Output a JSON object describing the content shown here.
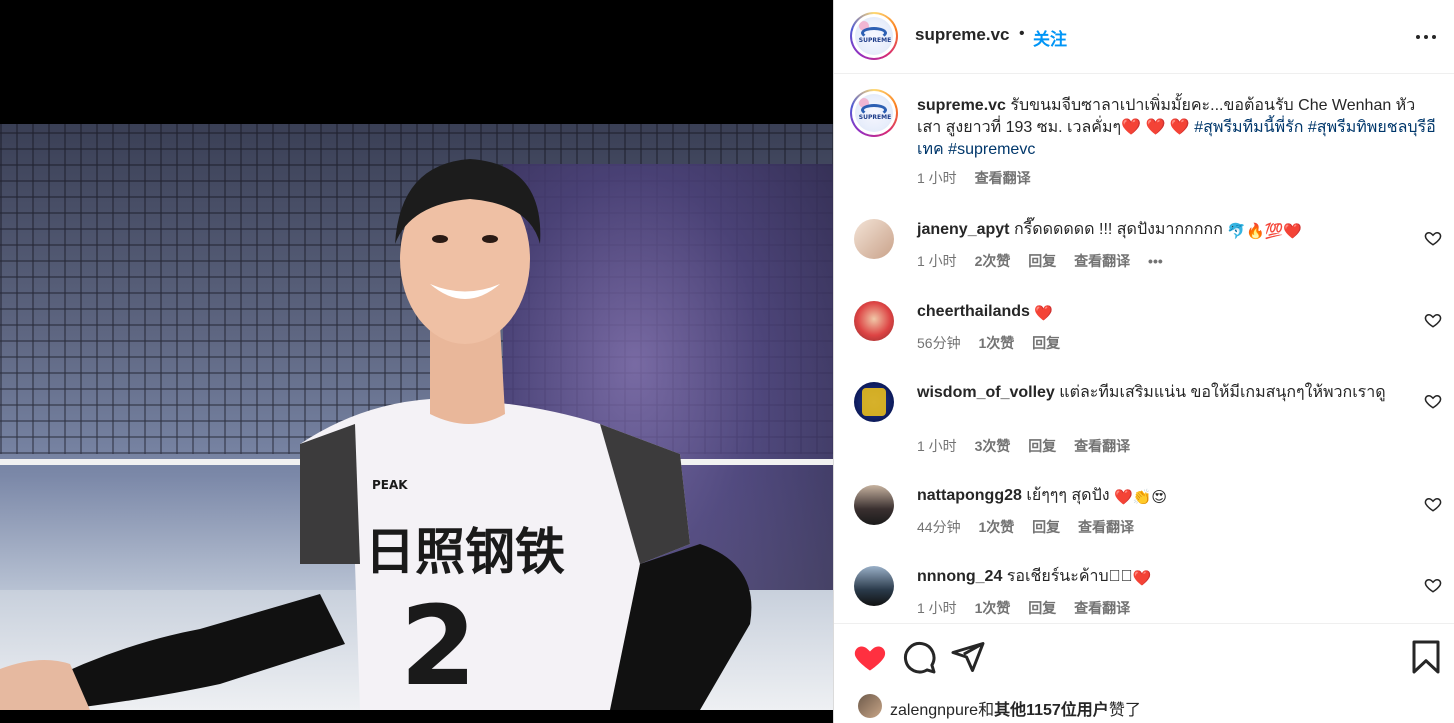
{
  "header": {
    "username": "supreme.vc",
    "separator": "•",
    "follow_label": "关注"
  },
  "caption": {
    "username": "supreme.vc",
    "text_part1": "รับขนมจีบซาลาเปาเพิ่มมั้ยคะ...ขอต้อนรับ Che Wenhan หัวเสา สูงยาวที่ 193 ซม. เวลคั่มๆ",
    "hearts": "❤️ ❤️ ❤️",
    "hashtag1": "#สุพรีมทีมนี้พี่รัก",
    "hashtag2": "#สุพรีมทิพยชลบุรีอีเทค",
    "hashtag3": "#supremevc",
    "time": "1 小时",
    "translate": "查看翻译"
  },
  "comments": [
    {
      "username": "janeny_apyt",
      "text": "กรี๊ดดดดดด !!! สุดปังมากกกกก",
      "emoji": "🐬🔥💯❤️",
      "time": "1 小时",
      "likes": "2次赞",
      "reply": "回复",
      "translate": "查看翻译",
      "more": "•••"
    },
    {
      "username": "cheerthailands",
      "text": "",
      "emoji": "❤️",
      "time": "56分钟",
      "likes": "1次赞",
      "reply": "回复"
    },
    {
      "username": "wisdom_of_volley",
      "text": "แต่ละทีมเสริมแน่น ขอให้มีเกมสนุกๆให้พวกเราดู",
      "emoji": "",
      "time": "1 小时",
      "likes": "3次赞",
      "reply": "回复",
      "translate": "查看翻译"
    },
    {
      "username": "nattapongg28",
      "text": "เย้ๆๆๆ สุดปัง",
      "emoji": "❤️👏😍",
      "time": "44分钟",
      "likes": "1次赞",
      "reply": "回复",
      "translate": "查看翻译"
    },
    {
      "username": "nnnong_24",
      "text": "รอเชียร์นะค้าบ􀀀􀀀",
      "emoji": "❤️",
      "time": "1 小时",
      "likes": "1次赞",
      "reply": "回复",
      "translate": "查看翻译"
    }
  ],
  "likes": {
    "user": "zalengnpure",
    "and": "和",
    "others": "其他1157位用户",
    "suffix": "赞了"
  },
  "photo": {
    "jersey_text": "日照钢铁",
    "jersey_number": "2",
    "brand": "PEAK"
  }
}
